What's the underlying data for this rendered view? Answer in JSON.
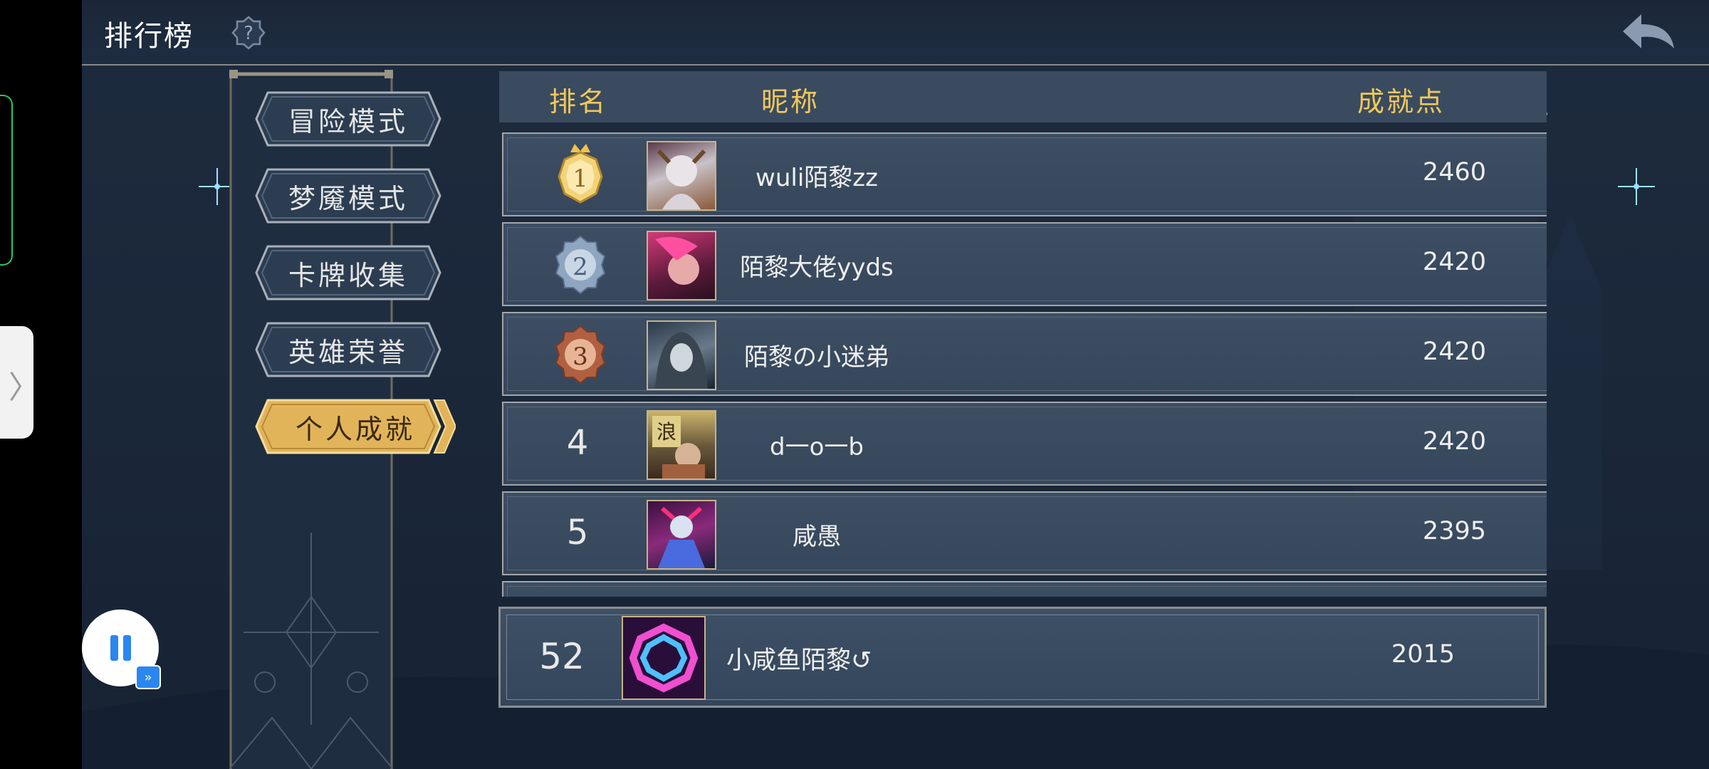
{
  "header": {
    "title": "排行榜",
    "help_icon": "question-mark-icon",
    "back_icon": "back-arrow-icon"
  },
  "tabs": [
    {
      "label": "冒险模式",
      "active": false
    },
    {
      "label": "梦魇模式",
      "active": false
    },
    {
      "label": "卡牌收集",
      "active": false
    },
    {
      "label": "英雄荣誉",
      "active": false
    },
    {
      "label": "个人成就",
      "active": true
    }
  ],
  "table": {
    "headers": {
      "rank": "排名",
      "nickname": "昵称",
      "points": "成就点"
    },
    "rows": [
      {
        "rank": "1",
        "nickname": "wuli陌黎zz",
        "points": "2460",
        "medal": "gold"
      },
      {
        "rank": "2",
        "nickname": "陌黎大佬yyds",
        "points": "2420",
        "medal": "silver"
      },
      {
        "rank": "3",
        "nickname": "陌黎の小迷弟",
        "points": "2420",
        "medal": "bronze"
      },
      {
        "rank": "4",
        "nickname": "d一o一b",
        "points": "2420",
        "medal": ""
      },
      {
        "rank": "5",
        "nickname": "咸愚",
        "points": "2395",
        "medal": ""
      }
    ]
  },
  "my_entry": {
    "rank": "52",
    "nickname": "小咸鱼陌黎↺",
    "points": "2015"
  },
  "colors": {
    "accent_gold": "#f2c85a",
    "row_bg": "#3a4b60",
    "header_bg": "#1b2738"
  },
  "overlay": {
    "pause_icon": "pause-icon",
    "fast_forward_icon": "fast-forward-icon"
  }
}
